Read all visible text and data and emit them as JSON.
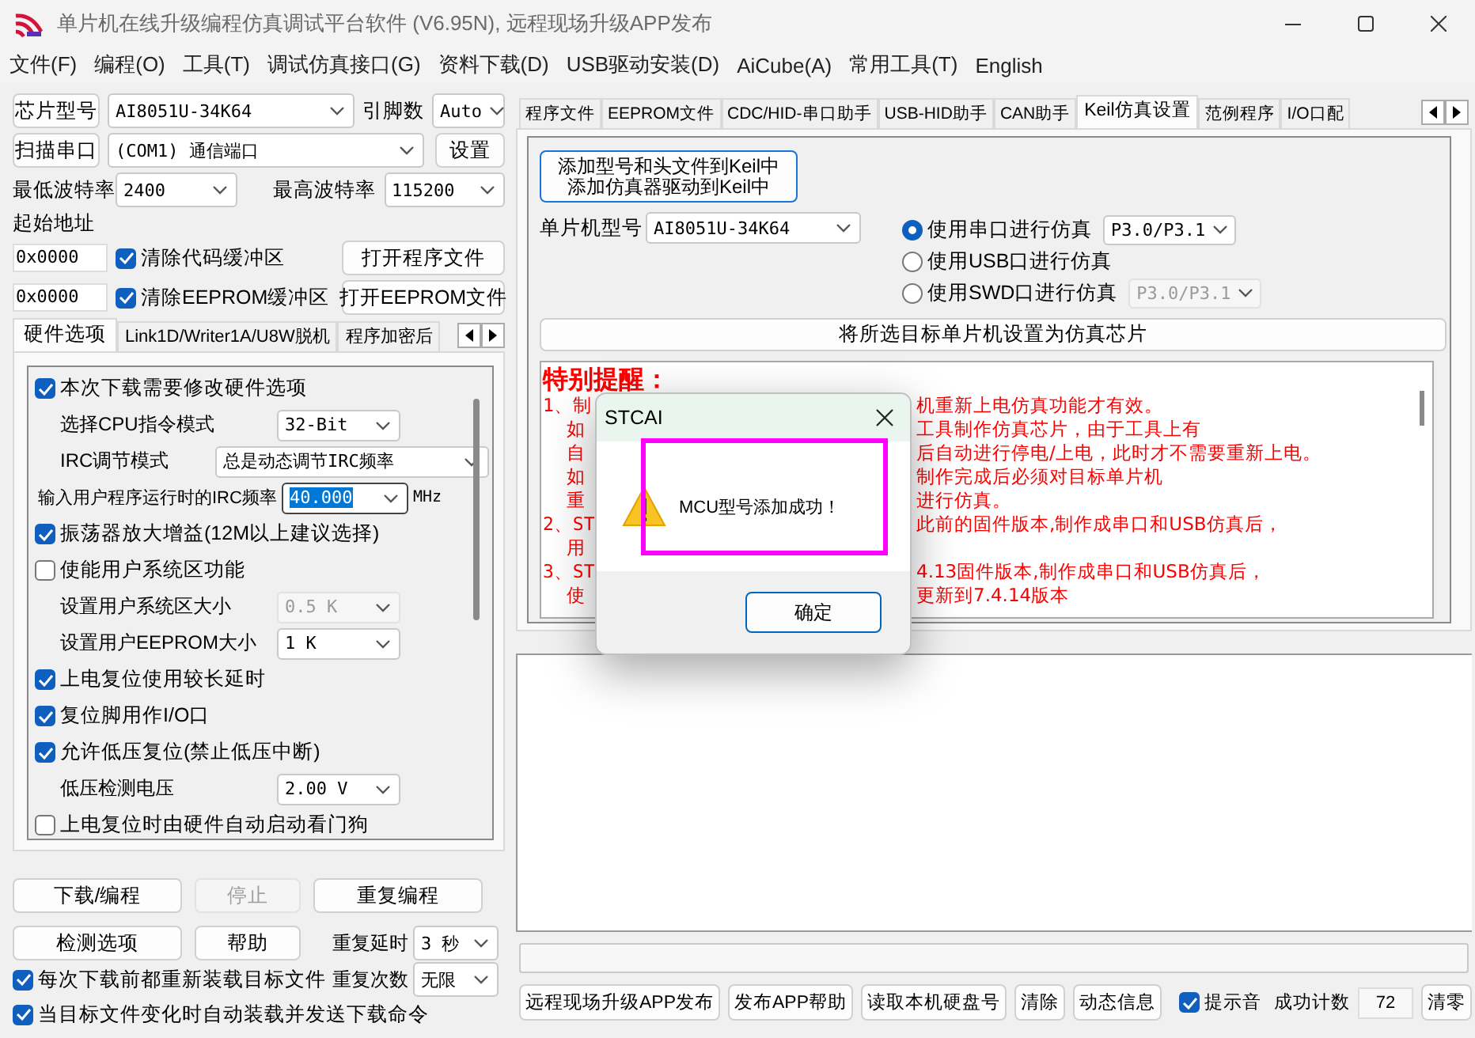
{
  "window": {
    "title": "单片机在线升级编程仿真调试平台软件 (V6.95N), 远程现场升级APP发布"
  },
  "menu": [
    "文件(F)",
    "编程(O)",
    "工具(T)",
    "调试仿真接口(G)",
    "资料下载(D)",
    "USB驱动安装(D)",
    "AiCube(A)",
    "常用工具(T)",
    "English"
  ],
  "chip": {
    "button": "芯片型号",
    "model": "AI8051U-34K64",
    "pins_label": "引脚数",
    "pins": "Auto"
  },
  "port": {
    "button": "扫描串口",
    "value": "(COM1) 通信端口",
    "settings": "设置"
  },
  "baud": {
    "min_label": "最低波特率",
    "min": "2400",
    "max_label": "最高波特率",
    "max": "115200"
  },
  "start_address": {
    "label": "起始地址",
    "rows": [
      {
        "address": "0x0000",
        "label": "清除代码缓冲区",
        "checked": true,
        "button": "打开程序文件"
      },
      {
        "address": "0x0000",
        "label": "清除EEPROM缓冲区",
        "checked": true,
        "button": "打开EEPROM文件"
      }
    ]
  },
  "left_tabs": [
    {
      "label": "硬件选项",
      "selected": true
    },
    {
      "label": "Link1D/Writer1A/U8W脱机",
      "selected": false
    },
    {
      "label": "程序加密后",
      "selected": false
    }
  ],
  "hardware_options": [
    {
      "kind": "check",
      "label": "本次下载需要修改硬件选项",
      "checked": true
    },
    {
      "kind": "select",
      "label": "选择CPU指令模式",
      "value": "32-Bit",
      "disabled": false
    },
    {
      "kind": "wide",
      "label": "IRC调节模式",
      "value": "总是动态调节IRC频率",
      "disabled": false
    },
    {
      "kind": "input",
      "label": "输入用户程序运行时的IRC频率",
      "value": "40.000",
      "highlighted": true,
      "unit": "MHz"
    },
    {
      "kind": "check",
      "label": "振荡器放大增益(12M以上建议选择)",
      "checked": true
    },
    {
      "kind": "check",
      "label": "使能用户系统区功能",
      "checked": false
    },
    {
      "kind": "select",
      "label": "设置用户系统区大小",
      "value": "0.5 K",
      "disabled": true
    },
    {
      "kind": "select",
      "label": "设置用户EEPROM大小",
      "value": "1    K",
      "disabled": false
    },
    {
      "kind": "check",
      "label": "上电复位使用较长延时",
      "checked": true
    },
    {
      "kind": "check",
      "label": "复位脚用作I/O口",
      "checked": true
    },
    {
      "kind": "check",
      "label": "允许低压复位(禁止低压中断)",
      "checked": true
    },
    {
      "kind": "select",
      "label": "低压检测电压",
      "value": "2.00 V",
      "disabled": false
    },
    {
      "kind": "check",
      "label": "上电复位时由硬件自动启动看门狗",
      "checked": false
    }
  ],
  "actions": [
    {
      "label": "下载/编程",
      "disabled": false
    },
    {
      "label": "停止",
      "disabled": true
    },
    {
      "label": "重复编程",
      "disabled": false
    },
    {
      "label": "检测选项",
      "disabled": false
    },
    {
      "label": "帮助",
      "disabled": false
    }
  ],
  "repeat": [
    {
      "label": "重复延时",
      "value": "3 秒"
    },
    {
      "label": "重复次数",
      "value": "无限"
    }
  ],
  "auto_options": [
    {
      "label": "每次下载前都重新装载目标文件",
      "checked": true
    },
    {
      "label": "当目标文件变化时自动装载并发送下载命令",
      "checked": true
    }
  ],
  "right_tabs": [
    {
      "label": "程序文件",
      "selected": false
    },
    {
      "label": "EEPROM文件",
      "selected": false
    },
    {
      "label": "CDC/HID-串口助手",
      "selected": false
    },
    {
      "label": "USB-HID助手",
      "selected": false
    },
    {
      "label": "CAN助手",
      "selected": false
    },
    {
      "label": "Keil仿真设置",
      "selected": true
    },
    {
      "label": "范例程序",
      "selected": false
    },
    {
      "label": "I/O口配",
      "selected": false
    }
  ],
  "keil": {
    "add_button": [
      "添加型号和头文件到Keil中",
      "添加仿真器驱动到Keil中"
    ],
    "mcu_label": "单片机型号",
    "mcu": "AI8051U-34K64",
    "modes": [
      {
        "label": "使用串口进行仿真",
        "selected": true,
        "port": "P3.0/P3.1",
        "port_disabled": false
      },
      {
        "label": "使用USB口进行仿真",
        "selected": false
      },
      {
        "label": "使用SWD口进行仿真",
        "selected": false,
        "port": "P3.0/P3.1",
        "port_disabled": true
      }
    ],
    "set_button": "将所选目标单片机设置为仿真芯片",
    "notice": {
      "title": "特别提醒：",
      "lines": [
        {
          "kind": "item",
          "left": "1、制",
          "right": "机重新上电仿真功能才有效。"
        },
        {
          "kind": "cont",
          "left": "如",
          "right": "工具制作仿真芯片，由于工具上有"
        },
        {
          "kind": "cont",
          "left": "自",
          "right": "后自动进行停电/上电，此时才不需要重新上电。"
        },
        {
          "kind": "cont",
          "left": "如",
          "right": "制作完成后必须对目标单片机"
        },
        {
          "kind": "cont",
          "left": "重",
          "right": "进行仿真。"
        },
        {
          "kind": "item",
          "left": "2、ST",
          "right": "此前的固件版本,制作成串口和USB仿真后，"
        },
        {
          "kind": "cont",
          "left": "用"
        },
        {
          "kind": "item",
          "left": "3、ST",
          "right": "4.13固件版本,制作成串口和USB仿真后，"
        },
        {
          "kind": "cont",
          "left": "使",
          "right": "更新到7.4.14版本"
        }
      ]
    }
  },
  "footer_buttons": [
    "远程现场升级APP发布",
    "发布APP帮助",
    "读取本机硬盘号",
    "清除",
    "动态信息"
  ],
  "beep": {
    "label": "提示音",
    "checked": true
  },
  "count": {
    "label": "成功计数",
    "value": "72"
  },
  "reset_button": "清零",
  "dialog": {
    "title": "STCAI",
    "message": "MCU型号添加成功！",
    "button": "确定"
  }
}
